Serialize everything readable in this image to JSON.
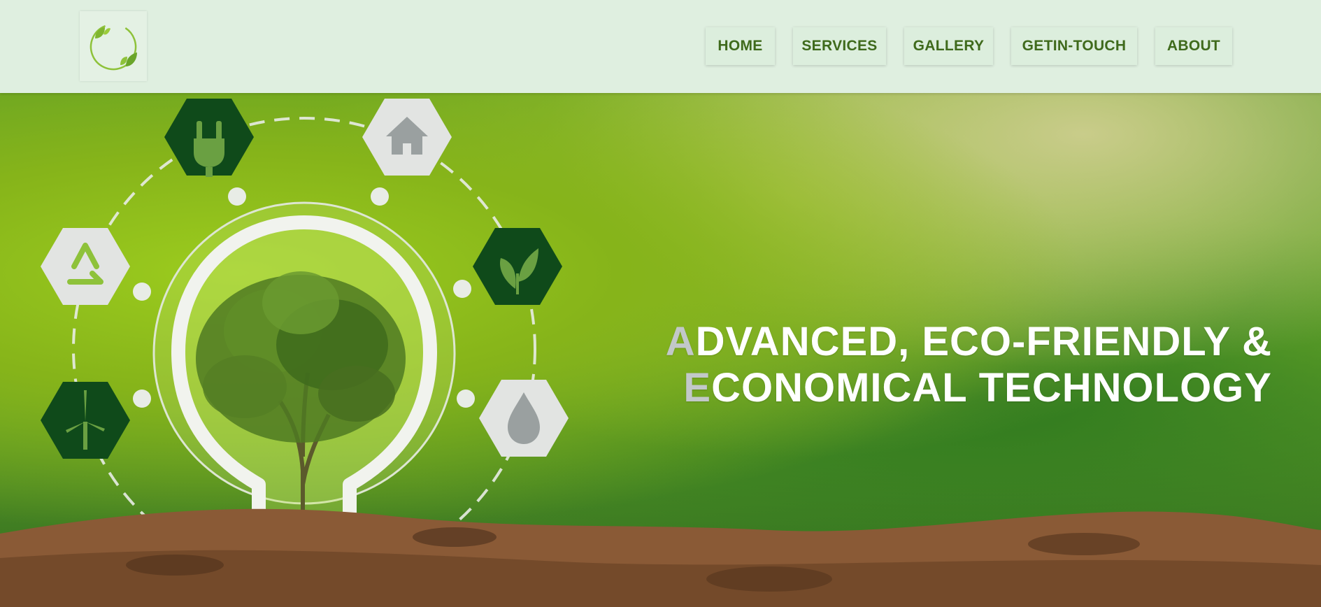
{
  "header": {
    "logo_alt": "eco leaf circle logo",
    "nav": [
      {
        "label": "HOME"
      },
      {
        "label": "SERVICES"
      },
      {
        "label": "GALLERY"
      },
      {
        "label": "GETIN-TOUCH"
      },
      {
        "label": "ABOUT"
      }
    ]
  },
  "hero": {
    "headline_line1_first": "A",
    "headline_line1_rest": "DVANCED, ECO-FRIENDLY &",
    "headline_line2_first": "E",
    "headline_line2_rest": "CONOMICAL TECHNOLOGY",
    "icons": [
      "plug-icon",
      "house-icon",
      "recycle-icon",
      "leaf-icon",
      "wind-turbine-icon",
      "water-drop-icon"
    ]
  },
  "colors": {
    "header_bg": "#dfefe0",
    "nav_text": "#3f6a1c",
    "dark_hex": "#0f4a1a",
    "light_hex": "#e2e4e2"
  }
}
